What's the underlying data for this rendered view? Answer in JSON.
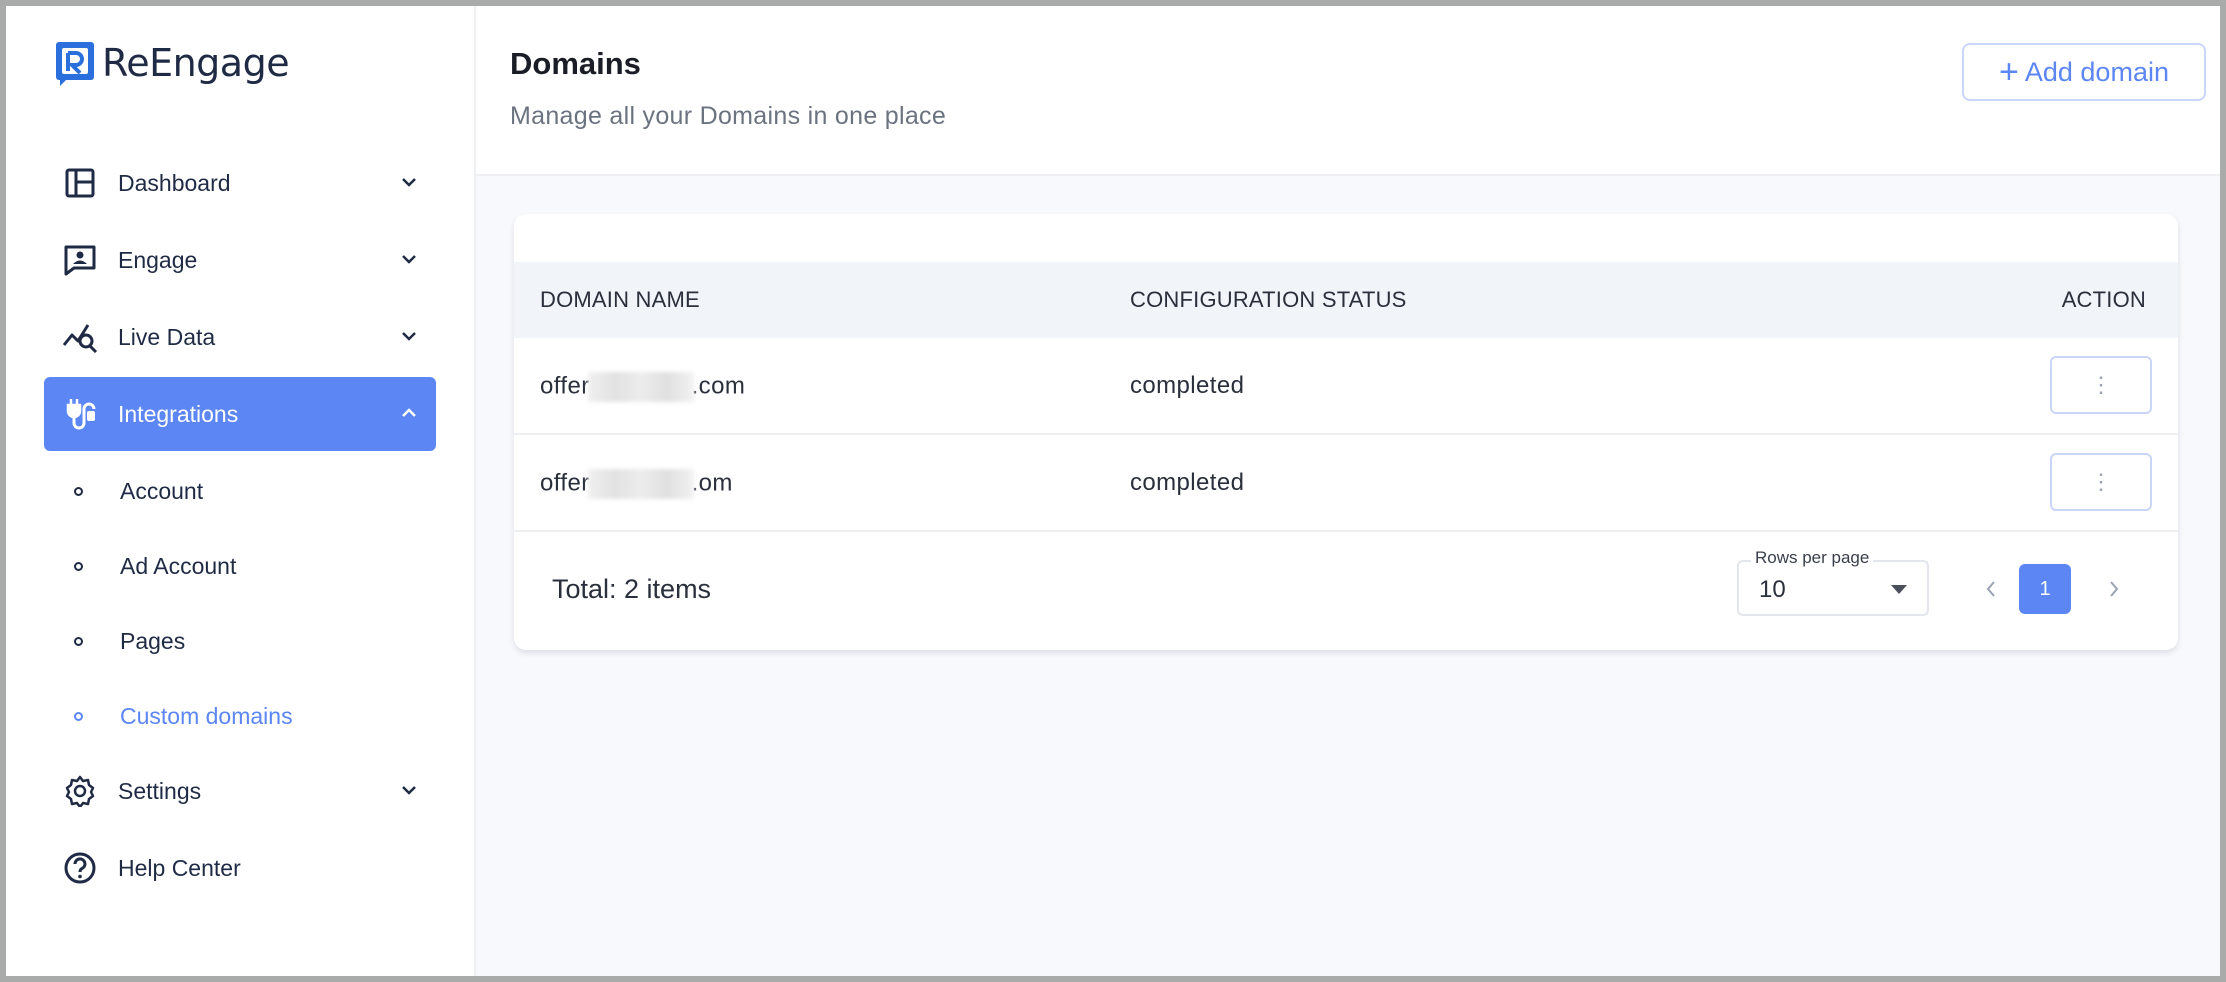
{
  "app": {
    "logo_text": "ReEngage",
    "accent": "#5b86f4"
  },
  "sidebar": {
    "items": [
      {
        "label": "Dashboard",
        "icon": "layout-icon"
      },
      {
        "label": "Engage",
        "icon": "chat-user-icon"
      },
      {
        "label": "Live Data",
        "icon": "chart-search-icon"
      },
      {
        "label": "Integrations",
        "icon": "integrations-icon",
        "active": true
      },
      {
        "label": "Settings",
        "icon": "gear-icon"
      },
      {
        "label": "Help Center",
        "icon": "help-icon"
      }
    ],
    "subitems": [
      {
        "label": "Account"
      },
      {
        "label": "Ad Account"
      },
      {
        "label": "Pages"
      },
      {
        "label": "Custom domains",
        "current": true
      }
    ]
  },
  "header": {
    "title": "Domains",
    "subtitle": "Manage all your Domains in one place",
    "add_button": "Add domain",
    "add_icon": "+"
  },
  "table": {
    "columns": [
      "DOMAIN NAME",
      "CONFIGURATION STATUS",
      "ACTION"
    ],
    "rows": [
      {
        "domain_prefix": "offer",
        "domain_suffix": "com",
        "status": "completed"
      },
      {
        "domain_prefix": "offer",
        "domain_suffix": "om",
        "status": "completed"
      }
    ],
    "kebab": "⋮"
  },
  "footer": {
    "total": "Total: 2 items",
    "rows_per_page_label": "Rows per page",
    "rows_per_page_value": "10",
    "current_page": "1"
  }
}
